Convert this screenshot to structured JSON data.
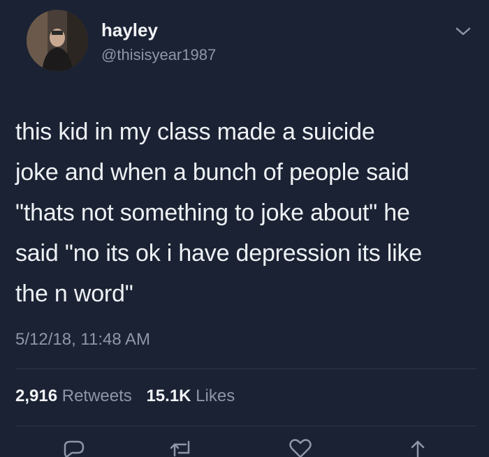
{
  "author": {
    "name": "hayley",
    "handle": "@thisisyear1987"
  },
  "icons": {
    "menu": "chevron-down-icon",
    "reply": "reply-icon",
    "retweet": "retweet-icon",
    "like": "heart-icon",
    "share": "share-icon"
  },
  "tweet": {
    "text": "this kid in my class made a suicide\njoke and when a bunch of people said\n\"thats not something to joke about\" he\nsaid \"no its ok i have depression its like\nthe n word\"",
    "timestamp": "5/12/18, 11:48 AM"
  },
  "stats": {
    "retweets_count": "2,916",
    "retweets_label": "Retweets",
    "likes_count": "15.1K",
    "likes_label": "Likes"
  },
  "colors": {
    "background": "#1b2233",
    "secondary_text": "#8d97a8",
    "primary_text": "#eef1f5"
  }
}
